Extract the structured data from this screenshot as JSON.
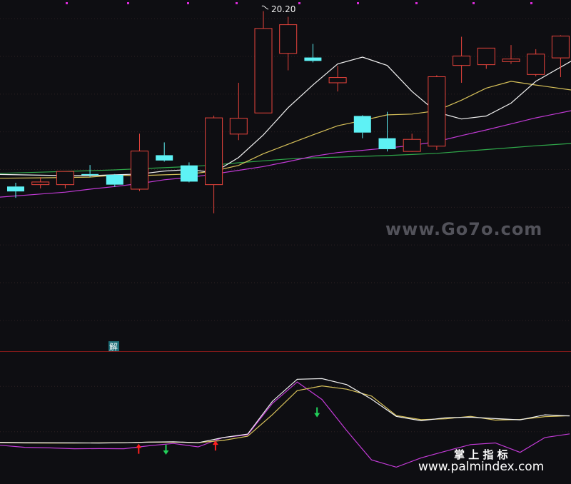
{
  "colors": {
    "background": "#0e0e12",
    "up_candle": "#e8443c",
    "down_candle": "#5ef2f5",
    "ma_white": "#f2f2f2",
    "ma_yellow": "#d8c25a",
    "ma_magenta": "#c23ad6",
    "ma_green": "#2fa84a",
    "divider": "#8a1a1a",
    "arrow_up": "#ff2020",
    "arrow_down": "#22d05a",
    "watermark": "#8b8b95"
  },
  "labels": {
    "high_price": "20.20",
    "sub_panel_tag": "解",
    "watermark_site": "www.Go7o.com",
    "watermark_brand": "掌 上 指 标",
    "watermark_url": "www.palmindex.com"
  },
  "chart_data": [
    {
      "type": "candlestick",
      "title": "",
      "ylim": [
        11.6,
        20.4
      ],
      "annotation": {
        "text": "20.20",
        "candle_index": 10
      },
      "candles": [
        {
          "o": 15.55,
          "h": 15.65,
          "l": 15.25,
          "c": 15.42
        },
        {
          "o": 15.6,
          "h": 15.8,
          "l": 15.5,
          "c": 15.67
        },
        {
          "o": 15.6,
          "h": 15.95,
          "l": 15.5,
          "c": 15.95
        },
        {
          "o": 15.88,
          "h": 16.12,
          "l": 15.8,
          "c": 15.85
        },
        {
          "o": 15.86,
          "h": 15.88,
          "l": 15.54,
          "c": 15.6
        },
        {
          "o": 15.48,
          "h": 16.95,
          "l": 15.43,
          "c": 16.49
        },
        {
          "o": 16.38,
          "h": 16.72,
          "l": 16.21,
          "c": 16.24
        },
        {
          "o": 16.11,
          "h": 16.19,
          "l": 15.66,
          "c": 15.68
        },
        {
          "o": 15.6,
          "h": 17.43,
          "l": 14.84,
          "c": 17.37
        },
        {
          "o": 16.94,
          "h": 18.3,
          "l": 16.78,
          "c": 17.36
        },
        {
          "o": 17.5,
          "h": 20.2,
          "l": 17.5,
          "c": 19.74
        },
        {
          "o": 19.08,
          "h": 20.05,
          "l": 18.63,
          "c": 19.84
        },
        {
          "o": 18.97,
          "h": 19.33,
          "l": 18.84,
          "c": 18.88
        },
        {
          "o": 18.3,
          "h": 18.75,
          "l": 18.07,
          "c": 18.44
        },
        {
          "o": 17.42,
          "h": 17.44,
          "l": 16.83,
          "c": 16.98
        },
        {
          "o": 16.83,
          "h": 17.53,
          "l": 16.48,
          "c": 16.54
        },
        {
          "o": 16.48,
          "h": 16.95,
          "l": 16.47,
          "c": 16.8
        },
        {
          "o": 16.62,
          "h": 18.5,
          "l": 16.52,
          "c": 18.46
        },
        {
          "o": 18.76,
          "h": 19.52,
          "l": 18.3,
          "c": 19.01
        },
        {
          "o": 18.78,
          "h": 19.22,
          "l": 18.67,
          "c": 19.22
        },
        {
          "o": 18.86,
          "h": 19.3,
          "l": 18.8,
          "c": 18.93
        },
        {
          "o": 18.52,
          "h": 19.19,
          "l": 18.47,
          "c": 19.06
        },
        {
          "o": 18.96,
          "h": 19.56,
          "l": 18.45,
          "c": 19.54
        }
      ],
      "series": [
        {
          "color": "#f2f2f2",
          "values": [
            15.87,
            15.85,
            15.84,
            15.84,
            15.86,
            15.88,
            15.96,
            16.0,
            15.92,
            16.32,
            16.92,
            17.64,
            18.24,
            18.8,
            18.98,
            18.76,
            18.07,
            17.52,
            17.34,
            17.42,
            17.76,
            18.34,
            18.87
          ]
        },
        {
          "color": "#d8c25a",
          "values": [
            15.77,
            15.78,
            15.79,
            15.8,
            15.85,
            15.84,
            15.86,
            15.88,
            15.96,
            16.11,
            16.42,
            16.67,
            16.92,
            17.16,
            17.3,
            17.45,
            17.47,
            17.56,
            17.84,
            18.16,
            18.34,
            18.24,
            18.11
          ]
        },
        {
          "color": "#c23ad6",
          "values": [
            15.27,
            15.35,
            15.4,
            15.48,
            15.55,
            15.63,
            15.73,
            15.79,
            15.88,
            15.98,
            16.08,
            16.21,
            16.35,
            16.45,
            16.51,
            16.57,
            16.64,
            16.74,
            16.9,
            17.05,
            17.21,
            17.37,
            17.56
          ]
        },
        {
          "color": "#2fa84a",
          "values": [
            15.9,
            15.93,
            15.95,
            15.97,
            15.99,
            16.02,
            16.05,
            16.08,
            16.12,
            16.18,
            16.23,
            16.28,
            16.31,
            16.33,
            16.35,
            16.37,
            16.4,
            16.43,
            16.48,
            16.53,
            16.58,
            16.63,
            16.69
          ]
        }
      ]
    },
    {
      "type": "line",
      "title": "",
      "ylim": [
        0,
        100
      ],
      "x": [
        0,
        1,
        2,
        3,
        4,
        5,
        6,
        7,
        8,
        9,
        10,
        11,
        12,
        13,
        14,
        15,
        16,
        17,
        18,
        19,
        20,
        21,
        22,
        23
      ],
      "series": [
        {
          "color": "#f2f2f2",
          "values": [
            6,
            5.6,
            5.5,
            5.3,
            5.1,
            5.5,
            6.3,
            6.8,
            5.5,
            12.3,
            16.9,
            60.3,
            89.3,
            90.2,
            82.3,
            63.1,
            40.3,
            34.5,
            38.5,
            39.2,
            37.4,
            35.8,
            42.4,
            40.9
          ]
        },
        {
          "color": "#d8c25a",
          "values": [
            5.7,
            5.2,
            5.1,
            5.1,
            5.3,
            5.5,
            6.2,
            6.3,
            5.7,
            8.5,
            14.1,
            42.6,
            74.3,
            80.6,
            76.2,
            67.2,
            41.4,
            35.9,
            37.2,
            40.4,
            35.4,
            36.2,
            39.9,
            41.1
          ]
        },
        {
          "color": "#c23ad6",
          "values": [
            2.2,
            -0.6,
            -1.3,
            -2.5,
            -2.3,
            -2.5,
            1.4,
            4.5,
            0,
            12.3,
            16,
            57.5,
            85.8,
            62.6,
            21.4,
            -17.2,
            -26.8,
            -14.5,
            -5.6,
            3,
            5.2,
            -7.3,
            12.4,
            17.2
          ]
        }
      ],
      "signals": [
        {
          "x": 5.6,
          "direction": "up",
          "color": "#ff2020"
        },
        {
          "x": 6.7,
          "direction": "down",
          "color": "#22d05a"
        },
        {
          "x": 8.7,
          "direction": "up",
          "color": "#ff2020"
        },
        {
          "x": 12.8,
          "direction": "down",
          "color": "#22d05a"
        }
      ]
    }
  ]
}
